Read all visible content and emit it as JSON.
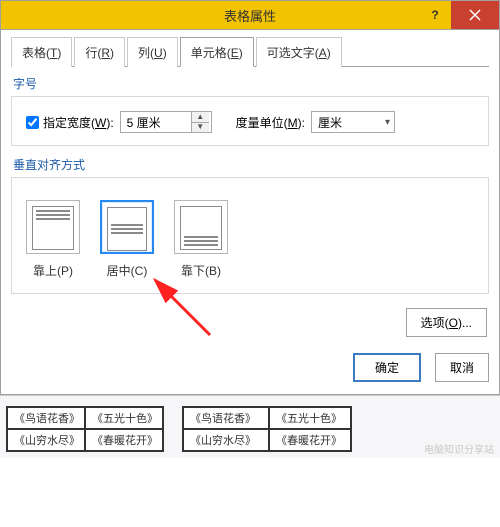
{
  "titlebar": {
    "title": "表格属性"
  },
  "tabs": {
    "table": {
      "prefix": "表格(",
      "accel": "T",
      "suffix": ")"
    },
    "row": {
      "prefix": "行(",
      "accel": "R",
      "suffix": ")"
    },
    "column": {
      "prefix": "列(",
      "accel": "U",
      "suffix": ")"
    },
    "cell": {
      "prefix": "单元格(",
      "accel": "E",
      "suffix": ")"
    },
    "alttext": {
      "prefix": "可选文字(",
      "accel": "A",
      "suffix": ")"
    }
  },
  "size_group": {
    "label": "字号",
    "checkbox": {
      "prefix": "指定宽度(",
      "accel": "W",
      "suffix": "):"
    },
    "width_value": "5 厘米",
    "unit_label": {
      "prefix": "度量单位(",
      "accel": "M",
      "suffix": "):"
    },
    "unit_value": "厘米"
  },
  "valign_group": {
    "label": "垂直对齐方式",
    "top": {
      "prefix": "靠上(",
      "accel": "P",
      "suffix": ")"
    },
    "center": {
      "prefix": "居中(",
      "accel": "C",
      "suffix": ")"
    },
    "bottom": {
      "prefix": "靠下(",
      "accel": "B",
      "suffix": ")"
    }
  },
  "buttons": {
    "options": {
      "prefix": "选项(",
      "accel": "O",
      "suffix": ")..."
    },
    "ok": "确定",
    "cancel": "取消"
  },
  "preview": {
    "left": {
      "r1c1": "《鸟语花香》",
      "r1c2": "《五光十色》",
      "r2c1": "《山穷水尽》",
      "r2c2": "《春暖花开》"
    },
    "right": {
      "r1c1": "《鸟语花香》",
      "r2c1": "《山穷水尽》",
      "cR1": "《五光十色》",
      "cR2": "《春暖花开》"
    }
  },
  "watermark": "电脑知识分享站"
}
